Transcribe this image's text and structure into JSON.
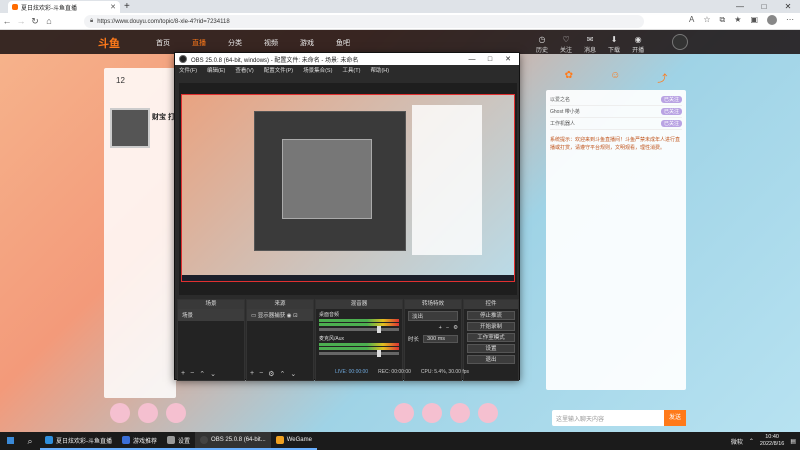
{
  "browser": {
    "tab_title": "夏日炫欢彩-斗鱼直播",
    "url": "https://www.douyu.com/topic/8-xle-4?rid=7234118",
    "window_buttons": [
      "—",
      "□",
      "✕"
    ]
  },
  "site": {
    "logo": "斗鱼",
    "nav": [
      "首页",
      "直播",
      "分类",
      "视频",
      "游戏",
      "鱼吧"
    ],
    "active_nav": "直播",
    "icons": [
      "历史",
      "关注",
      "消息",
      "下载",
      "开播"
    ],
    "left_count": "12",
    "streamer_name": "财宝 打",
    "chat_text": "系统提示：欢迎来到斗鱼直播间！斗鱼严禁未成年人进行直播或打赏，请遵守平台规则，文明观看，理性消费。",
    "send_placeholder": "这里输入聊天内容",
    "send_button": "发送",
    "rank_rows": [
      {
        "label": "以爱之名",
        "badge": "已关注"
      },
      {
        "label": "Ghost 带小弟",
        "badge": "已关注"
      },
      {
        "label": "工作机器人",
        "badge": "已关注"
      }
    ]
  },
  "obs": {
    "title": "OBS 25.0.8 (64-bit, windows) - 配置文件: 未命名 - 场景: 未命名",
    "menu": [
      "文件(F)",
      "编辑(E)",
      "查看(V)",
      "配置文件(P)",
      "场景集合(S)",
      "工具(T)",
      "帮助(H)"
    ],
    "docks": {
      "scenes": {
        "header": "场景",
        "items": [
          "场景"
        ]
      },
      "sources": {
        "header": "来源",
        "items": [
          "显示器捕获"
        ]
      },
      "mixer": {
        "header": "混音器",
        "rows": [
          "桌面音频",
          "麦克风/Aux"
        ]
      },
      "transitions": {
        "header": "转场特效",
        "type": "淡出",
        "duration_label": "时长",
        "duration": "300 ms"
      },
      "controls": {
        "header": "控件",
        "buttons": [
          "停止推流",
          "开始录制",
          "工作室模式",
          "设置",
          "退出"
        ]
      }
    },
    "status": {
      "live": "LIVE: 00:00:00",
      "rec": "REC: 00:00:00",
      "cpu": "CPU: 5.4%, 30.00 fps"
    }
  },
  "taskbar": {
    "apps": [
      {
        "label": "夏日炫欢彩-斗鱼直播",
        "color": "#2f8fdd"
      },
      {
        "label": "游戏推荐",
        "color": "#3b6fd8"
      },
      {
        "label": "设置",
        "color": "#999999"
      },
      {
        "label": "OBS 25.0.8 (64-bit...",
        "color": "#444444",
        "active": true
      },
      {
        "label": "WeGame",
        "color": "#f0a020"
      }
    ],
    "tray_label": "微软",
    "time": "10:40",
    "date": "2022/8/16"
  }
}
